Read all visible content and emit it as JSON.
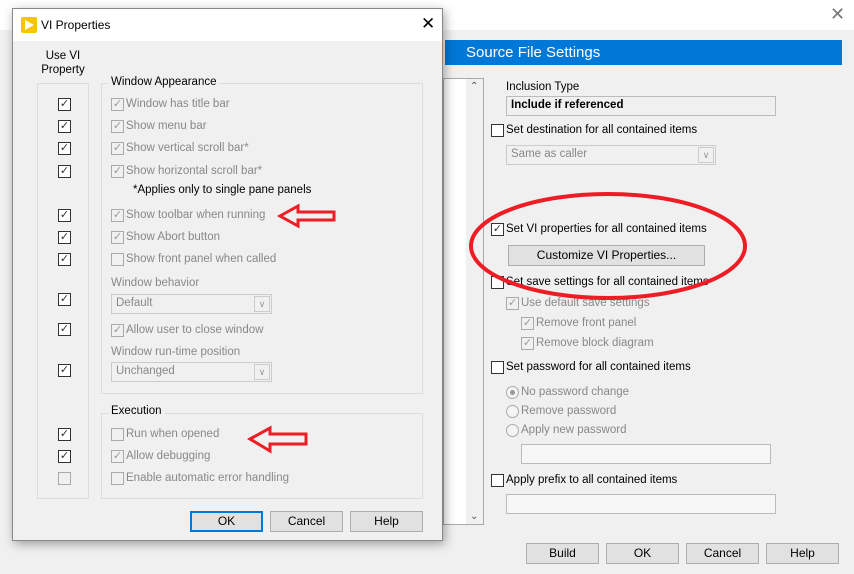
{
  "background_window": {
    "header": "Source File Settings",
    "inclusion_type_label": "Inclusion Type",
    "inclusion_type_value": "Include if referenced",
    "set_destination": {
      "label": "Set destination for all contained items",
      "checked": false
    },
    "destination_dropdown": "Same as caller",
    "set_vi_properties": {
      "label": "Set VI properties for all contained items",
      "checked": true
    },
    "customize_button": "Customize VI Properties...",
    "set_save_settings": {
      "label": "Set save settings for all contained items",
      "checked": false
    },
    "use_default_save": {
      "label": "Use default save settings",
      "checked": true
    },
    "remove_front_panel": {
      "label": "Remove front panel",
      "checked": true
    },
    "remove_block_diagram": {
      "label": "Remove block diagram",
      "checked": true
    },
    "set_password": {
      "label": "Set password for all contained items",
      "checked": false
    },
    "password_options": [
      {
        "label": "No password change",
        "selected": true
      },
      {
        "label": "Remove password",
        "selected": false
      },
      {
        "label": "Apply new password",
        "selected": false
      }
    ],
    "password_value": "",
    "apply_prefix": {
      "label": "Apply prefix to all contained items",
      "checked": false
    },
    "prefix_value": "",
    "buttons": {
      "build": "Build",
      "ok": "OK",
      "cancel": "Cancel",
      "help": "Help"
    }
  },
  "dialog": {
    "title": "VI Properties",
    "use_vi_property_header": "Use VI Property",
    "window_appearance": {
      "label": "Window Appearance",
      "items": [
        {
          "label": "Window has title bar",
          "checked": true,
          "use": true
        },
        {
          "label": "Show menu bar",
          "checked": true,
          "use": true
        },
        {
          "label": "Show vertical scroll bar*",
          "checked": true,
          "use": true
        },
        {
          "label": "Show horizontal scroll bar*",
          "checked": true,
          "use": true
        },
        {
          "label": "Show toolbar when running",
          "checked": true,
          "use": true
        },
        {
          "label": "Show Abort button",
          "checked": true,
          "use": true
        },
        {
          "label": "Show front panel when called",
          "checked": false,
          "use": true
        },
        {
          "label": "Allow user to close window",
          "checked": true,
          "use": true
        }
      ],
      "note": "*Applies only to single pane panels",
      "window_behavior_label": "Window behavior",
      "window_behavior_value": "Default",
      "window_behavior_use": true,
      "runtime_position_label": "Window run-time position",
      "runtime_position_value": "Unchanged",
      "runtime_position_use": true
    },
    "execution": {
      "label": "Execution",
      "items": [
        {
          "label": "Run when opened",
          "checked": false,
          "use": true
        },
        {
          "label": "Allow debugging",
          "checked": true,
          "use": true
        },
        {
          "label": "Enable automatic error handling",
          "checked": false,
          "use": false
        }
      ]
    },
    "buttons": {
      "ok": "OK",
      "cancel": "Cancel",
      "help": "Help"
    }
  },
  "annotation_color": "#ee1c25"
}
